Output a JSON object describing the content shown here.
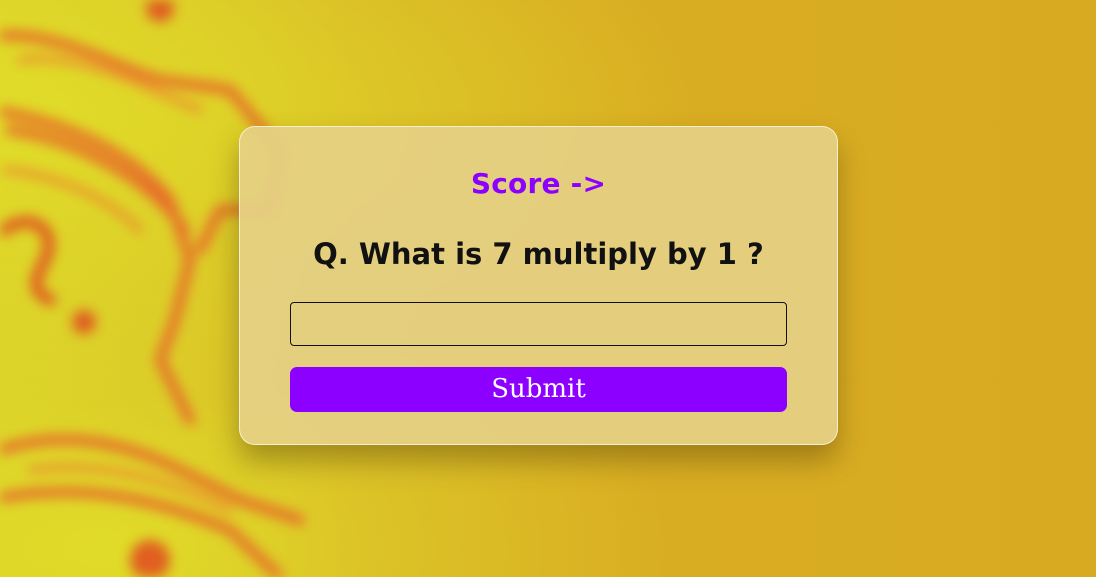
{
  "score": {
    "label": "Score ->"
  },
  "quiz": {
    "question": "Q. What is 7 multiply by 1 ?"
  },
  "answer": {
    "value": "",
    "placeholder": ""
  },
  "submit": {
    "label": "Submit"
  },
  "colors": {
    "accent": "#8c00ff",
    "background": "#d8ad24",
    "card": "#e5d086"
  }
}
